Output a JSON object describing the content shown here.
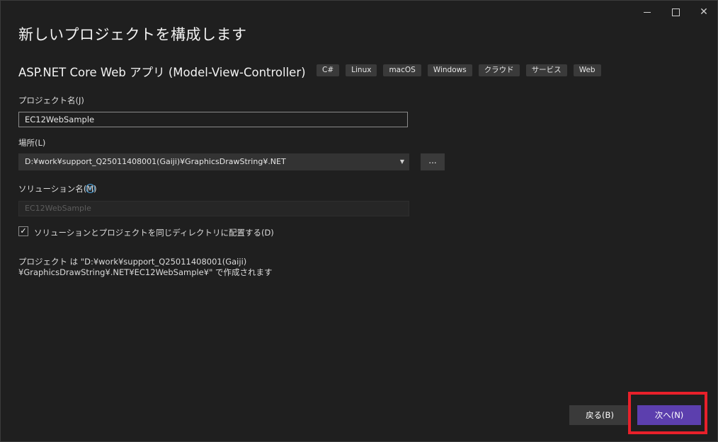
{
  "window": {
    "title": "新しいプロジェクトを構成します",
    "caption_buttons": {
      "minimize_icon": "minimize-icon",
      "maximize_icon": "maximize-icon",
      "close_icon": "close-icon",
      "close_glyph": "✕"
    }
  },
  "template": {
    "name": "ASP.NET Core Web アプリ (Model-View-Controller)",
    "tags": [
      "C#",
      "Linux",
      "macOS",
      "Windows",
      "クラウド",
      "サービス",
      "Web"
    ]
  },
  "form": {
    "project_name_label": "プロジェクト名(J)",
    "project_name_value": "EC12WebSample",
    "location_label": "場所(L)",
    "location_value": "D:¥work¥support_Q25011408001(Gaiji)¥GraphicsDrawString¥.NET",
    "browse_label": "...",
    "solution_name_label": "ソリューション名(M)",
    "solution_name_value": "EC12WebSample",
    "same_dir_checked": true,
    "same_dir_label": "ソリューションとプロジェクトを同じディレクトリに配置する(D)",
    "summary_text": "プロジェクト は \"D:¥work¥support_Q25011408001(Gaiji)¥GraphicsDrawString¥.NET¥EC12WebSample¥\" で作成されます"
  },
  "footer": {
    "back_label": "戻る(B)",
    "next_label": "次へ(N)"
  },
  "colors": {
    "accent": "#5c3fae",
    "highlight": "#e8202a",
    "info": "#4aa3df"
  }
}
